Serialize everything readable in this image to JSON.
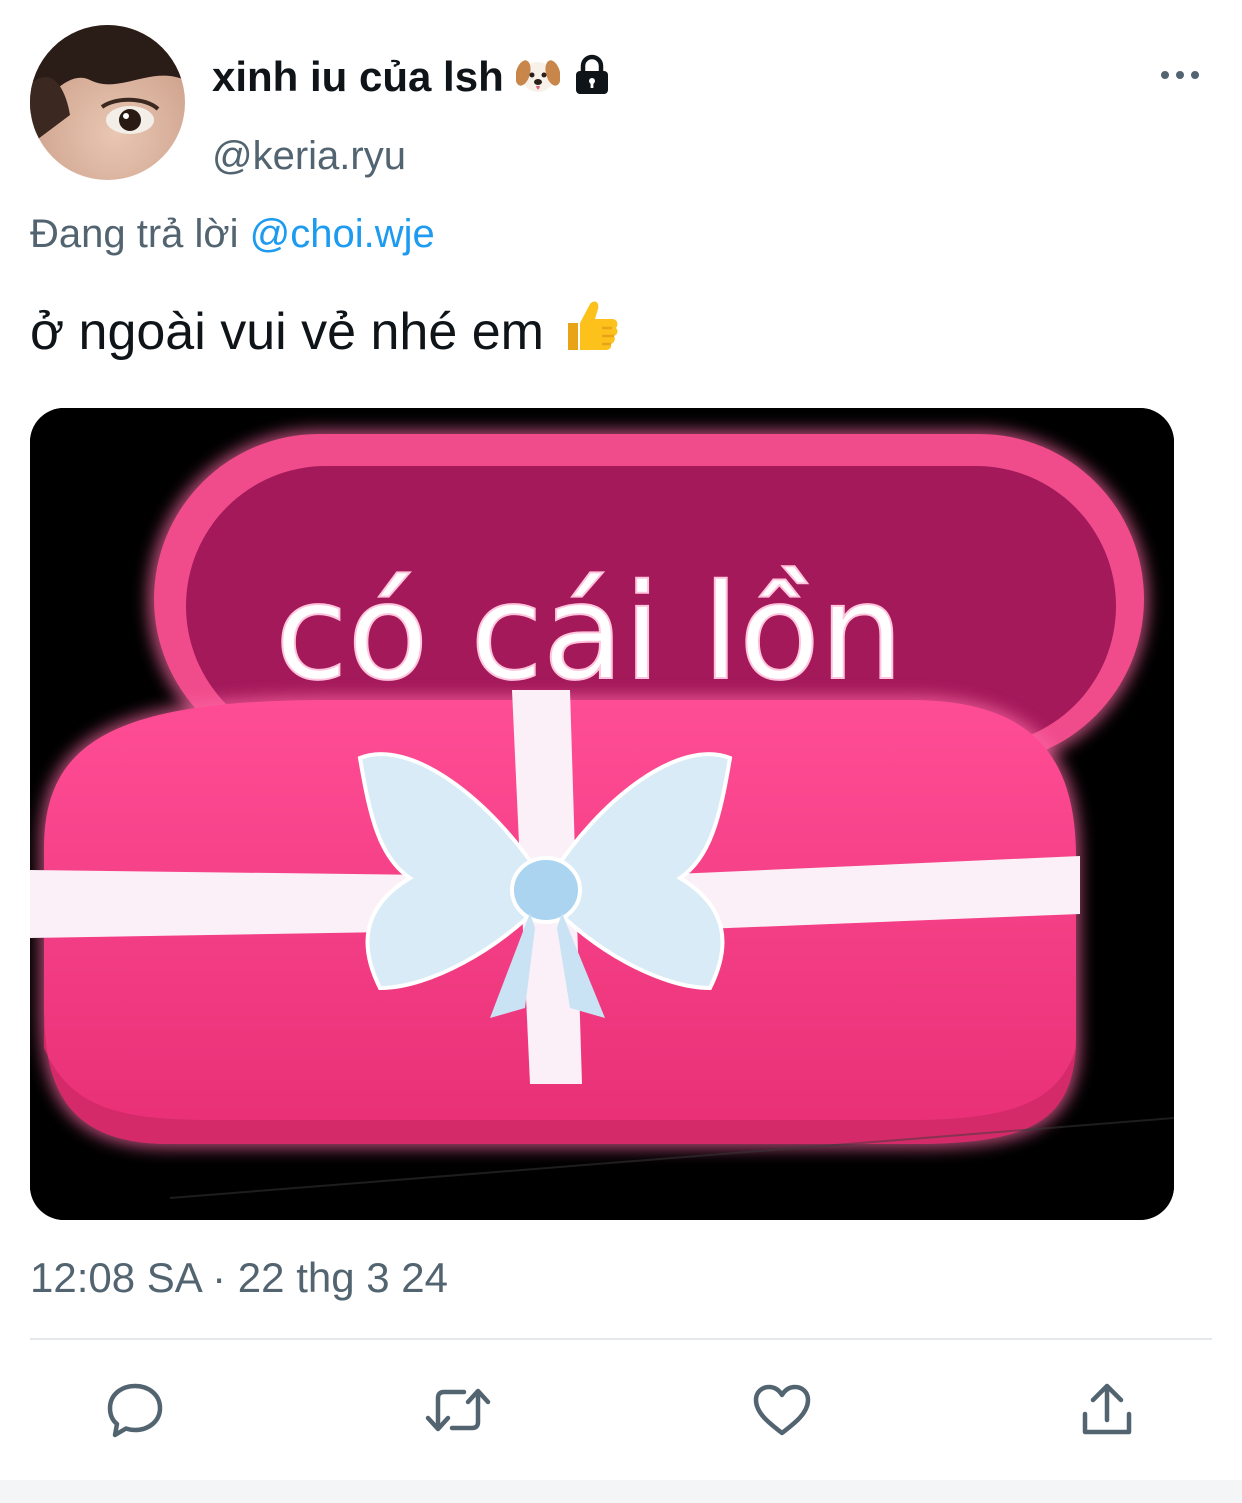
{
  "tweet": {
    "author": {
      "display_name": "xinh iu của lsh",
      "badges": [
        "dog-face-icon",
        "lock-icon"
      ],
      "handle": "@keria.ryu",
      "avatar": "avatar-photo"
    },
    "more_menu_icon": "more-icon",
    "reply_context": {
      "label": "Đang trả lời",
      "mention": "@choi.wje"
    },
    "text": "ở ngoài vui vẻ nhé em",
    "text_emoji": "thumbs-up-icon",
    "media": {
      "type": "image",
      "overlay_text": "có cái lồn"
    },
    "timestamp": "12:08 SA · 22 thg 3 24"
  },
  "actions": [
    {
      "name": "reply",
      "icon": "reply-icon"
    },
    {
      "name": "retweet",
      "icon": "retweet-icon"
    },
    {
      "name": "like",
      "icon": "heart-icon"
    },
    {
      "name": "share",
      "icon": "share-icon"
    }
  ],
  "colors": {
    "text_primary": "#0f1419",
    "text_secondary": "#536471",
    "link": "#1d9bf0",
    "icon": "#536471",
    "gift_pink": "#f23f84",
    "gift_lid": "#a51c55"
  }
}
